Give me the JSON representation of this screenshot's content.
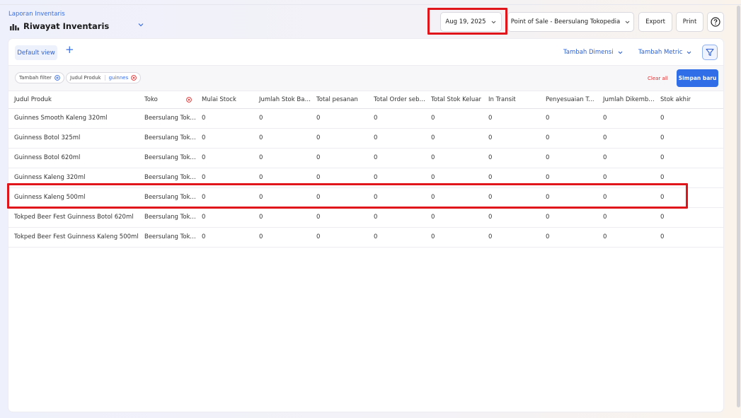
{
  "header": {
    "breadcrumb": "Laporan Inventaris",
    "title": "Riwayat Inventaris"
  },
  "toolbar": {
    "date": "Aug 19, 2025",
    "location": "Point of Sale - Beersulang Tokopedia",
    "export_label": "Export",
    "print_label": "Print"
  },
  "tabs": {
    "default_view": "Default view",
    "add": "+",
    "tambah_dimensi": "Tambah Dimensi",
    "tambah_metric": "Tambah Metric"
  },
  "filters": {
    "add_filter": "Tambah filter",
    "chip_label": "Judul Produk",
    "chip_value": "guinnes",
    "clear_all": "Clear all",
    "save": "Simpan baru"
  },
  "table": {
    "columns": [
      "Judul Produk",
      "Toko",
      "Mulai Stock",
      "Jumlah Stok Baru",
      "Total pesanan",
      "Total Order sebelumnya",
      "Total Stok Keluar",
      "In Transit",
      "Penyesuaian Total",
      "Jumlah Dikembalikan",
      "Stok akhir"
    ],
    "rows": [
      [
        "Guinnes Smooth Kaleng 320ml",
        "Beersulang Tokopedia",
        "0",
        "0",
        "0",
        "0",
        "0",
        "0",
        "0",
        "0",
        "0"
      ],
      [
        "Guinness Botol 325ml",
        "Beersulang Tokopedia",
        "0",
        "0",
        "0",
        "0",
        "0",
        "0",
        "0",
        "0",
        "0"
      ],
      [
        "Guinness Botol 620ml",
        "Beersulang Tokopedia",
        "0",
        "0",
        "0",
        "0",
        "0",
        "0",
        "0",
        "0",
        "0"
      ],
      [
        "Guinness Kaleng 320ml",
        "Beersulang Tokopedia",
        "0",
        "0",
        "0",
        "0",
        "0",
        "0",
        "0",
        "0",
        "0"
      ],
      [
        "Guinness Kaleng 500ml",
        "Beersulang Tokopedia",
        "0",
        "0",
        "0",
        "0",
        "0",
        "0",
        "0",
        "0",
        "0"
      ],
      [
        "Tokped Beer Fest Guinness Botol 620ml",
        "Beersulang Tokopedia",
        "0",
        "0",
        "0",
        "0",
        "0",
        "0",
        "0",
        "0",
        "0"
      ],
      [
        "Tokped Beer Fest Guinness Kaleng 500ml",
        "Beersulang Tokopedia",
        "0",
        "0",
        "0",
        "0",
        "0",
        "0",
        "0",
        "0",
        "0"
      ]
    ]
  },
  "icons": {
    "title": "chart-icon",
    "chevron": "chevron-down-icon",
    "help": "help-icon",
    "filter": "filter-icon",
    "add_circle": "plus-circle-icon",
    "remove_circle": "close-circle-icon"
  },
  "colors": {
    "accent": "#2f6ee6",
    "highlight": "#e0141b",
    "danger": "#e03131"
  }
}
